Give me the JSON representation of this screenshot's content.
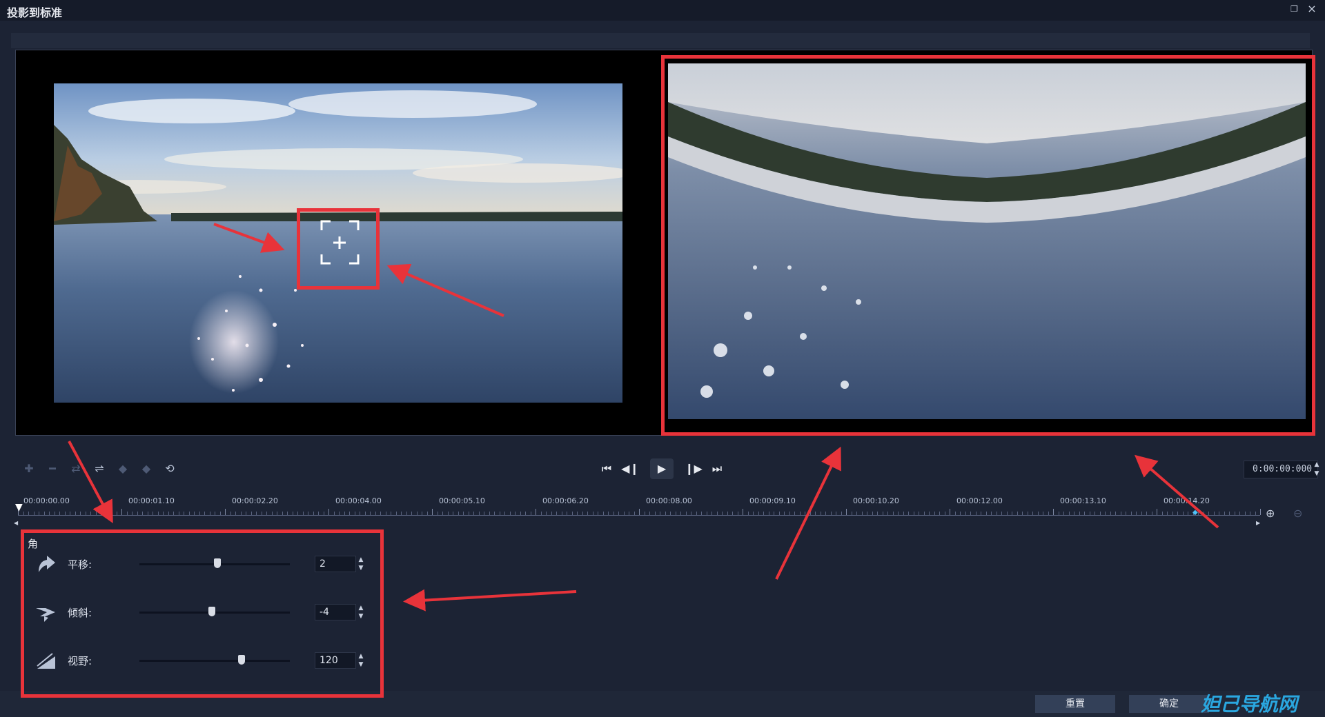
{
  "window": {
    "title": "投影到标准",
    "restore_icon": "restore-window-icon",
    "close_icon": "close-icon",
    "close_glyph": "×",
    "restore_glyph": "❐"
  },
  "preview": {
    "original_label": "",
    "result_label": ""
  },
  "toolbar": {
    "left_icons": [
      "add-keyframe-icon",
      "remove-keyframe-icon",
      "reverse-keyframe-icon",
      "swap-icon",
      "prev-keyframe-icon",
      "next-keyframe-icon",
      "reset-keyframe-icon"
    ],
    "left_glyphs": [
      "✚",
      "━",
      "⇄",
      "⇌",
      "◆",
      "◆",
      "⟲"
    ],
    "playback_icons": [
      "go-to-start-icon",
      "step-back-icon",
      "play-icon",
      "step-forward-icon",
      "go-to-end-icon"
    ],
    "playback_glyphs": [
      "⏮",
      "◀❙",
      "▶",
      "❙▶",
      "⏭"
    ],
    "timecode": "0:00:00:000",
    "spin_up": "▲",
    "spin_down": "▼"
  },
  "timeline": {
    "labels": [
      "00:00:00.00",
      "00:00:01.10",
      "00:00:02.20",
      "00:00:04.00",
      "00:00:05.10",
      "00:00:06.20",
      "00:00:08.00",
      "00:00:09.10",
      "00:00:10.20",
      "00:00:12.00",
      "00:00:13.10",
      "00:00:14.20"
    ],
    "playhead_glyph": "▼",
    "keyframe_glyph": "◆",
    "left_arrow": "◀",
    "right_arrow": "▶",
    "zoom_in_glyph": "⊕",
    "zoom_out_glyph": "⊖"
  },
  "properties": {
    "section": "角",
    "rows": [
      {
        "label": "平移:",
        "value": "2",
        "slider_fraction": 0.52,
        "icon": "pan-icon"
      },
      {
        "label": "倾斜:",
        "value": "-4",
        "slider_fraction": 0.48,
        "icon": "tilt-icon"
      },
      {
        "label": "视野:",
        "value": "120",
        "slider_fraction": 0.68,
        "icon": "field-of-view-icon"
      }
    ]
  },
  "buttons": {
    "reset": "重置",
    "ok": "确定"
  },
  "watermark": "妲己导航网",
  "colors": {
    "annotation": "#e8333a",
    "background": "#1c2334",
    "keyframe": "#4fc3f7"
  }
}
